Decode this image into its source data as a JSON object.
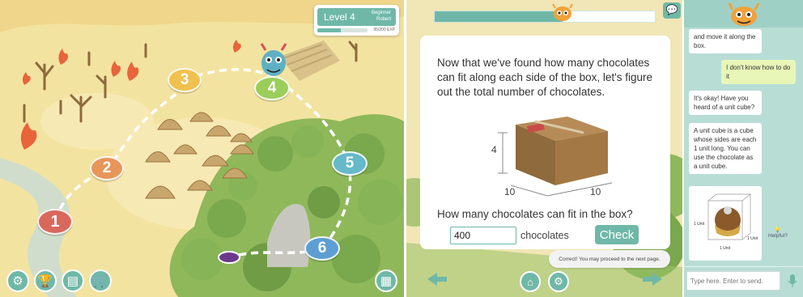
{
  "map": {
    "level_label": "Level 4",
    "rank": "Beginner",
    "player_name": "Robert",
    "exp_text": "95/200 EXP",
    "exp_fraction": 0.475,
    "nodes": [
      {
        "label": "1",
        "color": "#d9685c"
      },
      {
        "label": "2",
        "color": "#e8955a"
      },
      {
        "label": "3",
        "color": "#f0c14f"
      },
      {
        "label": "4",
        "color": "#9bcd5b"
      },
      {
        "label": "5",
        "color": "#65b9c9"
      },
      {
        "label": "6",
        "color": "#5d9fd3"
      }
    ],
    "bottom_icons": [
      "gear-icon",
      "trophy-icon",
      "notebook-icon",
      "cart-icon"
    ],
    "map_icon": "map-icon"
  },
  "problem": {
    "progress_fraction": 0.58,
    "text": "Now that we've found how many chocolates can fit along each side of the box, let's figure out the total number of chocolates.",
    "dim_height": "4",
    "dim_width": "10",
    "dim_depth": "10",
    "question": "How many chocolates can fit in the box?",
    "answer_value": "400",
    "unit": "chocolates",
    "check_label": "Check",
    "toast": "Correct! You may proceed to the next page."
  },
  "chat": {
    "messages": [
      {
        "from": "bot",
        "text": "and move it along the box."
      },
      {
        "from": "user",
        "text": "I don't know how to do it"
      },
      {
        "from": "bot",
        "text": "It's okay! Have you heard of a unit cube?"
      },
      {
        "from": "bot",
        "text": "A unit cube is a cube whose sides are each 1 unit long. You can use the chocolate as a unit cube."
      }
    ],
    "cube_labels": {
      "left": "1 Unit",
      "right": "1 Unit",
      "bottom": "1 Unit"
    },
    "helpful_label": "Helpful?",
    "input_placeholder": "Type here. Enter to send.",
    "colors": {
      "accent": "#6fb8a8",
      "panel": "#b8ddd5",
      "user_bubble": "#e8f6b8"
    }
  }
}
